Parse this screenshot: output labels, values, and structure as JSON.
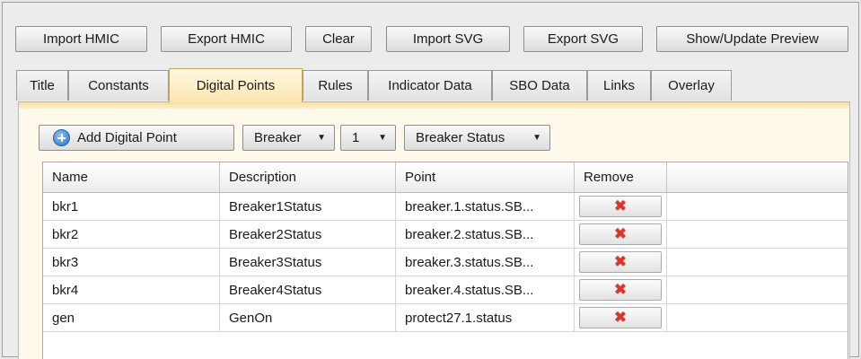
{
  "toolbar": {
    "buttons": [
      "Import HMIC",
      "Export HMIC",
      "Clear",
      "Import SVG",
      "Export SVG",
      "Show/Update Preview"
    ]
  },
  "tabs": [
    "Title",
    "Constants",
    "Digital Points",
    "Rules",
    "Indicator Data",
    "SBO Data",
    "Links",
    "Overlay"
  ],
  "active_tab": "Digital Points",
  "controls": {
    "add_label": "Add Digital Point",
    "add_icon": "plus-circle-icon",
    "device_type": "Breaker",
    "device_number": "1",
    "point_type": "Breaker Status"
  },
  "grid": {
    "columns": [
      "Name",
      "Description",
      "Point",
      "Remove"
    ],
    "remove_icon": "red-x-icon",
    "rows": [
      {
        "name": "bkr1",
        "description": "Breaker1Status",
        "point": "breaker.1.status.SB..."
      },
      {
        "name": "bkr2",
        "description": "Breaker2Status",
        "point": "breaker.2.status.SB..."
      },
      {
        "name": "bkr3",
        "description": "Breaker3Status",
        "point": "breaker.3.status.SB..."
      },
      {
        "name": "bkr4",
        "description": "Breaker4Status",
        "point": "breaker.4.status.SB..."
      },
      {
        "name": "gen",
        "description": "GenOn",
        "point": "protect27.1.status"
      }
    ]
  },
  "colors": {
    "active_tab": "#fbe6b0",
    "panel_bg": "#fef9ea",
    "remove_icon": "#d9372a",
    "add_icon": "#2f72c4"
  }
}
